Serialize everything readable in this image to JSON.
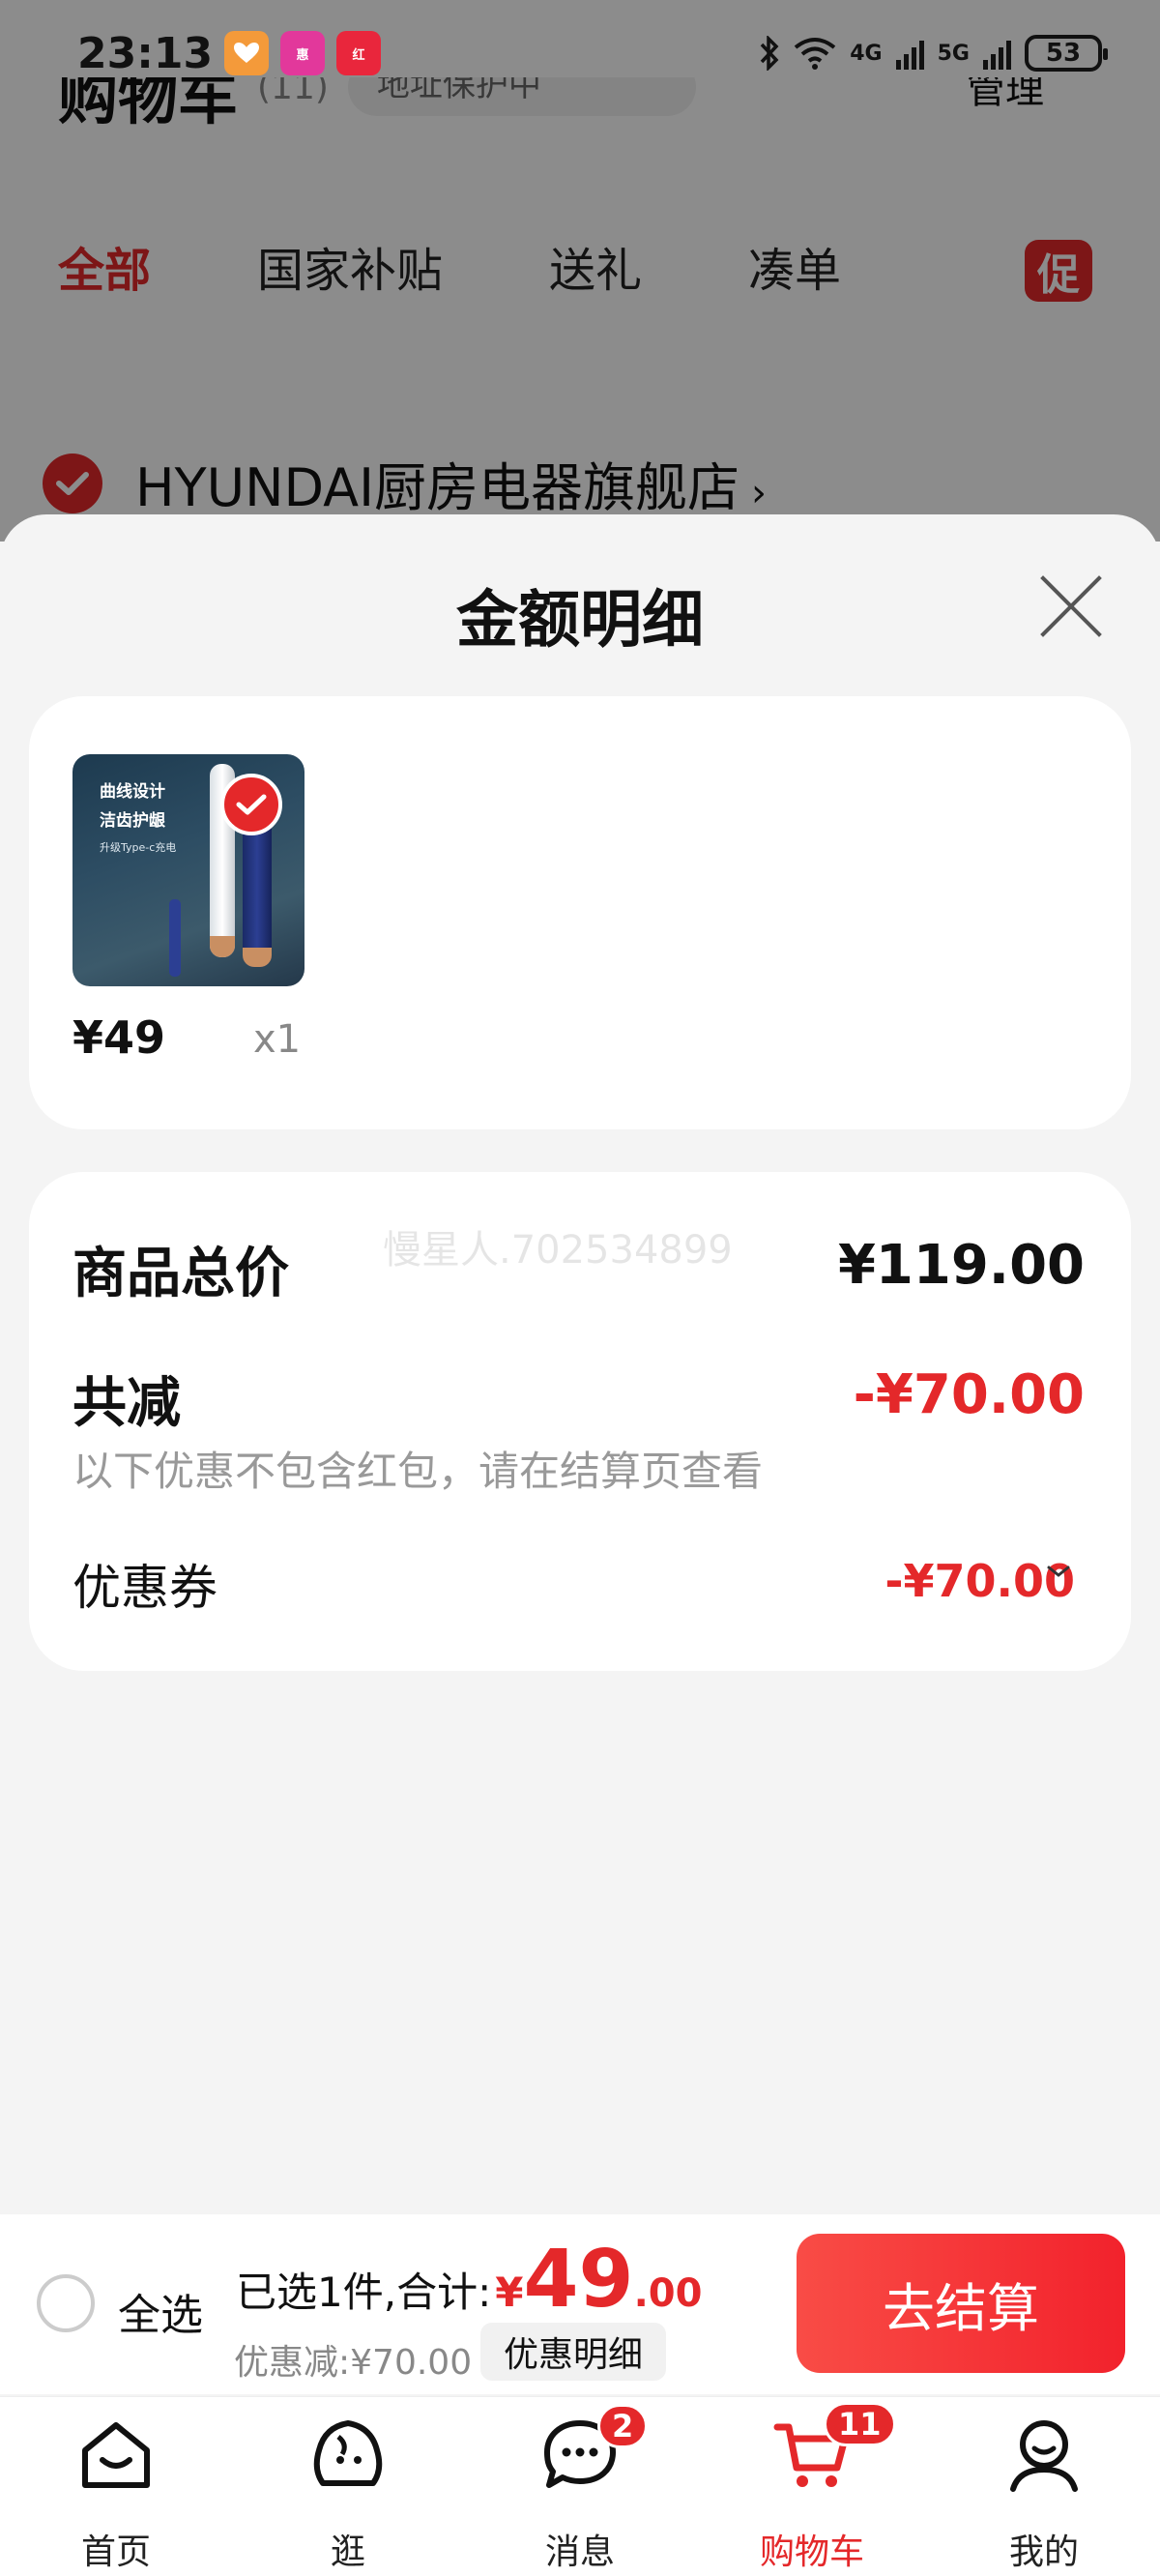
{
  "status_bar": {
    "time": "23:13",
    "apps": [
      "health-app-icon",
      "shopping-app-icon",
      "xiaohongshu-app-icon"
    ],
    "network_4g": "4G",
    "network_5g": "5G",
    "battery": "53"
  },
  "background": {
    "cart_title": "购物车",
    "cart_count": "(11)",
    "address_label": "地址保护中",
    "manage_label": "管理",
    "tabs": [
      "全部",
      "国家补贴",
      "送礼",
      "凑单"
    ],
    "promo_tab_label": "促",
    "store_name": "HYUNDAI厨房电器旗舰店",
    "store_chevron": "›"
  },
  "sheet": {
    "title": "金额明细",
    "item": {
      "image_lines": [
        "曲线设计",
        "洁齿护龈",
        "升级Type-c充电"
      ],
      "price": "¥49",
      "quantity": "x1"
    },
    "watermark": "慢星人.702534899",
    "total_label": "商品总价",
    "total_value": "¥119.00",
    "reduce_label": "共减",
    "reduce_value": "-¥70.00",
    "reduce_note": "以下优惠不包含红包，请在结算页查看",
    "coupon_label": "优惠券",
    "coupon_value": "-¥70.00"
  },
  "checkout": {
    "select_all": "全选",
    "selected_summary": "已选1件,合计:",
    "currency": "¥",
    "amount_int": "49",
    "amount_dec": ".00",
    "discount": "优惠减:¥70.00",
    "detail_button": "优惠明细",
    "checkout_button": "去结算"
  },
  "tabbar": {
    "items": [
      {
        "label": "首页",
        "icon": "home-icon"
      },
      {
        "label": "逛",
        "icon": "browse-icon"
      },
      {
        "label": "消息",
        "icon": "message-icon",
        "badge": "2"
      },
      {
        "label": "购物车",
        "icon": "cart-icon",
        "badge": "11",
        "active": true
      },
      {
        "label": "我的",
        "icon": "profile-icon"
      }
    ]
  },
  "colors": {
    "accent": "#e4282a",
    "sheet_bg": "#f4f4f4",
    "muted_text": "#999999"
  }
}
